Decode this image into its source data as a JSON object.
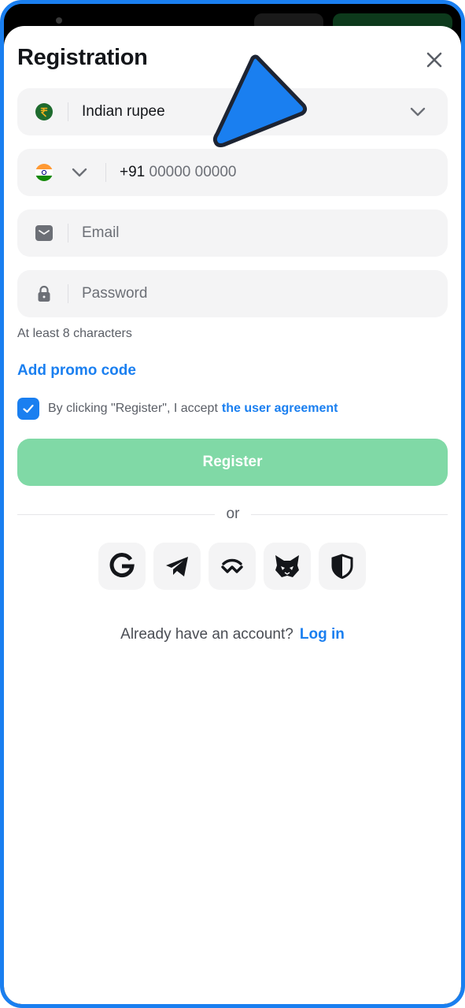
{
  "header": {
    "title": "Registration"
  },
  "currency": {
    "label": "Indian rupee",
    "icon": "rupee-coin-icon"
  },
  "phone": {
    "flag_icon": "india-flag-icon",
    "prefix": "+91",
    "placeholder": "00000 00000"
  },
  "email": {
    "placeholder": "Email",
    "icon": "envelope-icon"
  },
  "password": {
    "placeholder": "Password",
    "icon": "lock-icon",
    "hint": "At least 8 characters"
  },
  "promo": {
    "label": "Add promo code"
  },
  "agreement": {
    "checked": true,
    "text": "By clicking \"Register\", I accept",
    "link": "the user agreement"
  },
  "register": {
    "label": "Register",
    "color": "#80d9a6"
  },
  "divider": {
    "label": "or"
  },
  "socials": [
    "google-icon",
    "telegram-icon",
    "walletconnect-icon",
    "metamask-fox-icon",
    "shield-icon"
  ],
  "login": {
    "question": "Already have an account?",
    "link": "Log in"
  },
  "colors": {
    "accent": "#1a7ff0",
    "field_bg": "#f4f4f5",
    "text": "#14161a"
  }
}
